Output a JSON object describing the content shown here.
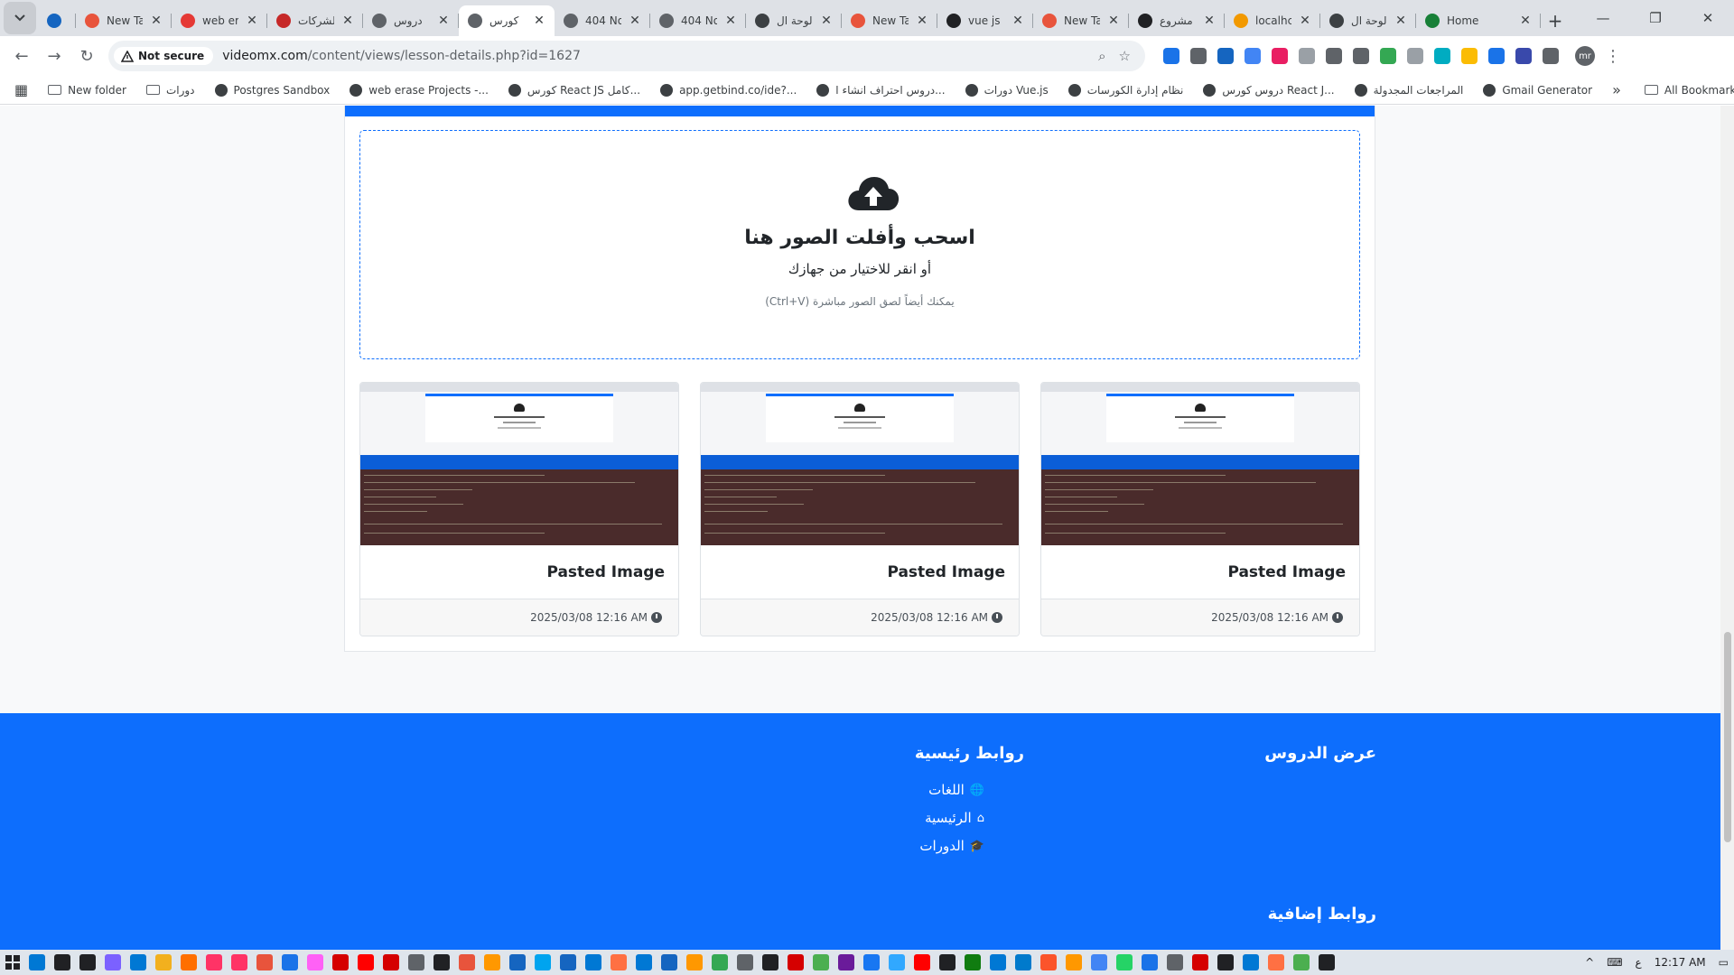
{
  "browser": {
    "tabs": [
      {
        "title": "",
        "favicon_color": "#1565c0"
      },
      {
        "title": "New Ta",
        "favicon_color": "#e8543c"
      },
      {
        "title": "web er",
        "favicon_color": "#e53935"
      },
      {
        "title": "الشركات",
        "favicon_color": "#c62828"
      },
      {
        "title": "دروس",
        "favicon_color": "#5f6368"
      },
      {
        "title": "كورس",
        "favicon_color": "#5f6368",
        "active": true
      },
      {
        "title": "404 No",
        "favicon_color": "#5f6368"
      },
      {
        "title": "404 No",
        "favicon_color": "#5f6368"
      },
      {
        "title": "لوحة ال",
        "favicon_color": "#3c4043"
      },
      {
        "title": "New Ta",
        "favicon_color": "#e8543c"
      },
      {
        "title": "vue js",
        "favicon_color": "#202124"
      },
      {
        "title": "New Ta",
        "favicon_color": "#e8543c"
      },
      {
        "title": "مشروع",
        "favicon_color": "#202124"
      },
      {
        "title": "localhc",
        "favicon_color": "#f29900"
      },
      {
        "title": "لوحة ال",
        "favicon_color": "#3c4043"
      },
      {
        "title": "Home",
        "favicon_color": "#188038"
      }
    ],
    "close_glyph": "✕",
    "new_tab_glyph": "+",
    "window_controls": {
      "minimize": "—",
      "restore": "❐",
      "close": "✕"
    },
    "nav": {
      "back": "←",
      "forward": "→",
      "reload": "↻"
    },
    "security_label": "Not secure",
    "url_host": "videomx.com",
    "url_path": "/content/views/lesson-details.php?id=1627",
    "omni_zoom_icon": "⌕",
    "omni_star_icon": "☆",
    "extension_colors": [
      "#1a73e8",
      "#5f6368",
      "#1565c0",
      "#4285f4",
      "#e91e63",
      "#9aa0a6",
      "#5f6368",
      "#5f6368",
      "#34a853",
      "#9aa0a6",
      "#00acc1",
      "#fbbc04",
      "#1a73e8",
      "#3949ab",
      "#5f6368"
    ],
    "profile_initials": "mr",
    "menu_glyph": "⋮"
  },
  "bookmarks": {
    "apps_glyph": "▦",
    "items": [
      {
        "label": "New folder",
        "type": "folder"
      },
      {
        "label": "دورات",
        "type": "folder"
      },
      {
        "label": "Postgres Sandbox",
        "type": "site"
      },
      {
        "label": "web erase Projects -...",
        "type": "site"
      },
      {
        "label": "كورس React JS كامل...",
        "type": "site"
      },
      {
        "label": "app.getbind.co/ide?...",
        "type": "site"
      },
      {
        "label": "دروس احتراف انشاء ا...",
        "type": "site"
      },
      {
        "label": "دورات Vue.js",
        "type": "site"
      },
      {
        "label": "نظام إدارة الكورسات",
        "type": "site"
      },
      {
        "label": "دروس كورس React J...",
        "type": "site"
      },
      {
        "label": "المراجعات المجدولة",
        "type": "site"
      },
      {
        "label": "Gmail Generator",
        "type": "site"
      }
    ],
    "overflow_glyph": "»",
    "all_bookmarks_label": "All Bookmarks"
  },
  "dropzone": {
    "title": "اسحب وأفلت الصور هنا",
    "subtitle": "أو انقر للاختيار من جهازك",
    "hint": "يمكنك أيضاً لصق الصور مباشرة (Ctrl+V)"
  },
  "images": [
    {
      "title": "Pasted Image",
      "date": "2025/03/08 12:16 AM"
    },
    {
      "title": "Pasted Image",
      "date": "2025/03/08 12:16 AM"
    },
    {
      "title": "Pasted Image",
      "date": "2025/03/08 12:16 AM"
    }
  ],
  "footer": {
    "col1_title": "عرض الدروس",
    "col2_title": "روابط رئيسية",
    "col2_links": [
      {
        "label": "اللغات",
        "icon": "globe-icon",
        "glyph": "🌐"
      },
      {
        "label": "الرئيسية",
        "icon": "home-icon",
        "glyph": "⌂"
      },
      {
        "label": "الدورات",
        "icon": "graduation-cap-icon",
        "glyph": "🎓"
      }
    ],
    "col3_title": "روابط إضافية"
  },
  "taskbar": {
    "icon_colors": [
      "#0078d4",
      "#202124",
      "#202124",
      "#7b61ff",
      "#0078d4",
      "#f2b01e",
      "#ff6f00",
      "#ff3366",
      "#ff3366",
      "#e8543c",
      "#1a73e8",
      "#ff61f6",
      "#d50000",
      "#ff0000",
      "#d50000",
      "#5f6368",
      "#202124",
      "#e8543c",
      "#ff9800",
      "#1565c0",
      "#00a4ef",
      "#1565c0",
      "#0078d4",
      "#ff7043",
      "#0078d4",
      "#1565c0",
      "#ff9800",
      "#34a853",
      "#5f6368",
      "#202124",
      "#d50000",
      "#4caf50",
      "#6a1b9a",
      "#1877f2",
      "#31a8ff",
      "#ff0000",
      "#202124",
      "#107c10",
      "#0078d4",
      "#007acc",
      "#fb542b",
      "#ff9800",
      "#4285f4",
      "#25d366",
      "#1a73e8",
      "#5f6368",
      "#d50000",
      "#202124",
      "#0078d4",
      "#ff7043",
      "#4caf50",
      "#202124"
    ],
    "tray_chevron": "^",
    "keyboard_glyph": "⌨",
    "lang": "ع",
    "time": "12:17 AM",
    "notification_glyph": "▭"
  }
}
